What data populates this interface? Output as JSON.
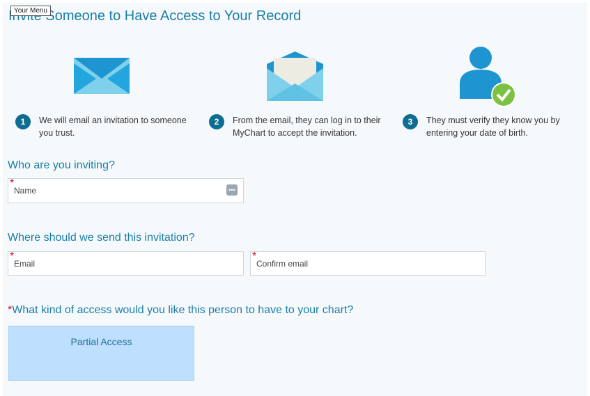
{
  "menu": {
    "label": "Your Menu"
  },
  "page": {
    "title": "Invite Someone to Have Access to Your Record"
  },
  "steps": [
    {
      "number": "1",
      "text_line1": "We will email an invitation to someone",
      "text_line2": "you trust."
    },
    {
      "number": "2",
      "text_line1": "From the email, they can log in to their",
      "text_line2": "MyChart to accept the invitation."
    },
    {
      "number": "3",
      "text_line1": "They must verify they know you by",
      "text_line2": "entering your date of birth."
    }
  ],
  "who": {
    "heading": "Who are you inviting?",
    "name_placeholder": "Name",
    "required_mark": "*",
    "more_icon": "ellipsis-icon"
  },
  "where": {
    "heading": "Where should we send this invitation?",
    "email_placeholder": "Email",
    "confirm_placeholder": "Confirm email",
    "required_mark": "*"
  },
  "access": {
    "required_mark": "*",
    "heading": "What kind of access would you like this person to have to your chart?",
    "options": [
      {
        "label": "Partial Access"
      }
    ]
  },
  "colors": {
    "accent": "#1a7fa6",
    "step_circle": "#0e6d91",
    "required": "#c8102e",
    "access_card": "#bfdfff",
    "icon_blue": "#1e95d1",
    "icon_light": "#7fd0ea",
    "check_green": "#7cc242"
  }
}
